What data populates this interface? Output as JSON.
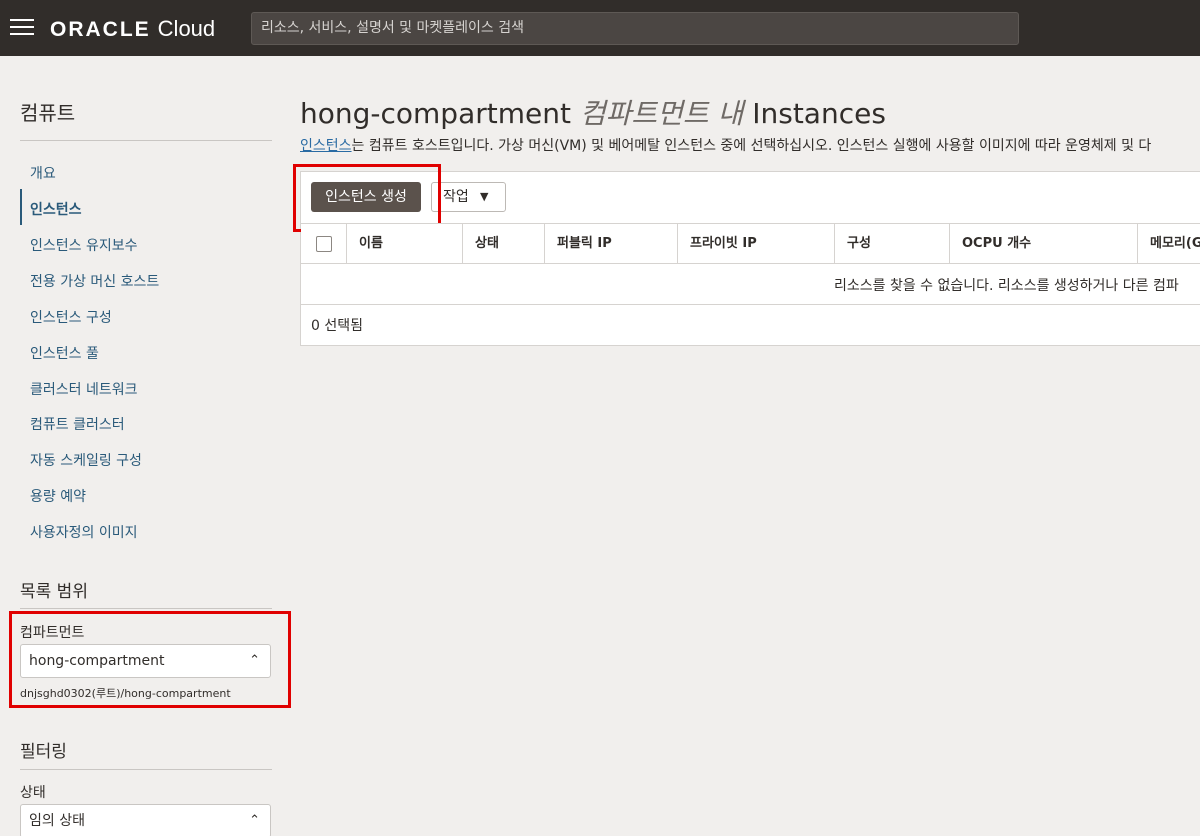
{
  "topbar": {
    "brand": "ORACLE",
    "product": "Cloud",
    "search_placeholder": "리소스, 서비스, 설명서 및 마켓플레이스 검색"
  },
  "sidebar": {
    "title": "컴퓨트",
    "items": [
      {
        "label": "개요"
      },
      {
        "label": "인스턴스",
        "active": true
      },
      {
        "label": "인스턴스 유지보수"
      },
      {
        "label": "전용 가상 머신 호스트"
      },
      {
        "label": "인스턴스 구성"
      },
      {
        "label": "인스턴스 풀"
      },
      {
        "label": "클러스터 네트워크"
      },
      {
        "label": "컴퓨트 클러스터"
      },
      {
        "label": "자동 스케일링 구성"
      },
      {
        "label": "용량 예약"
      },
      {
        "label": "사용자정의 이미지"
      }
    ],
    "scope_title": "목록 범위",
    "compartment_label": "컴파트먼트",
    "compartment_value": "hong-compartment",
    "compartment_path": "dnjsghd0302(루트)/hong-compartment",
    "filter_title": "필터링",
    "state_label": "상태",
    "state_value": "임의 상태"
  },
  "main": {
    "title_name": "hong-compartment",
    "title_italic": "컴파트먼트 내",
    "title_suffix": "Instances",
    "desc_link": "인스턴스",
    "desc_text": "는 컴퓨트 호스트입니다. 가상 머신(VM) 및 베어메탈 인스턴스 중에 선택하십시오. 인스턴스 실행에 사용할 이미지에 따라 운영체제 및 다",
    "create_button": "인스턴스 생성",
    "actions_button": "작업",
    "columns": [
      "이름",
      "상태",
      "퍼블릭 IP",
      "프라이빗 IP",
      "구성",
      "OCPU 개수",
      "메모리(G"
    ],
    "empty_message": "리소스를 찾을 수 없습니다. 리소스를 생성하거나 다른 컴파",
    "selected_count": "0 선택됨"
  },
  "colors": {
    "highlight": "#e00000",
    "topbar": "#312d2a",
    "link": "#2a5a7a"
  }
}
